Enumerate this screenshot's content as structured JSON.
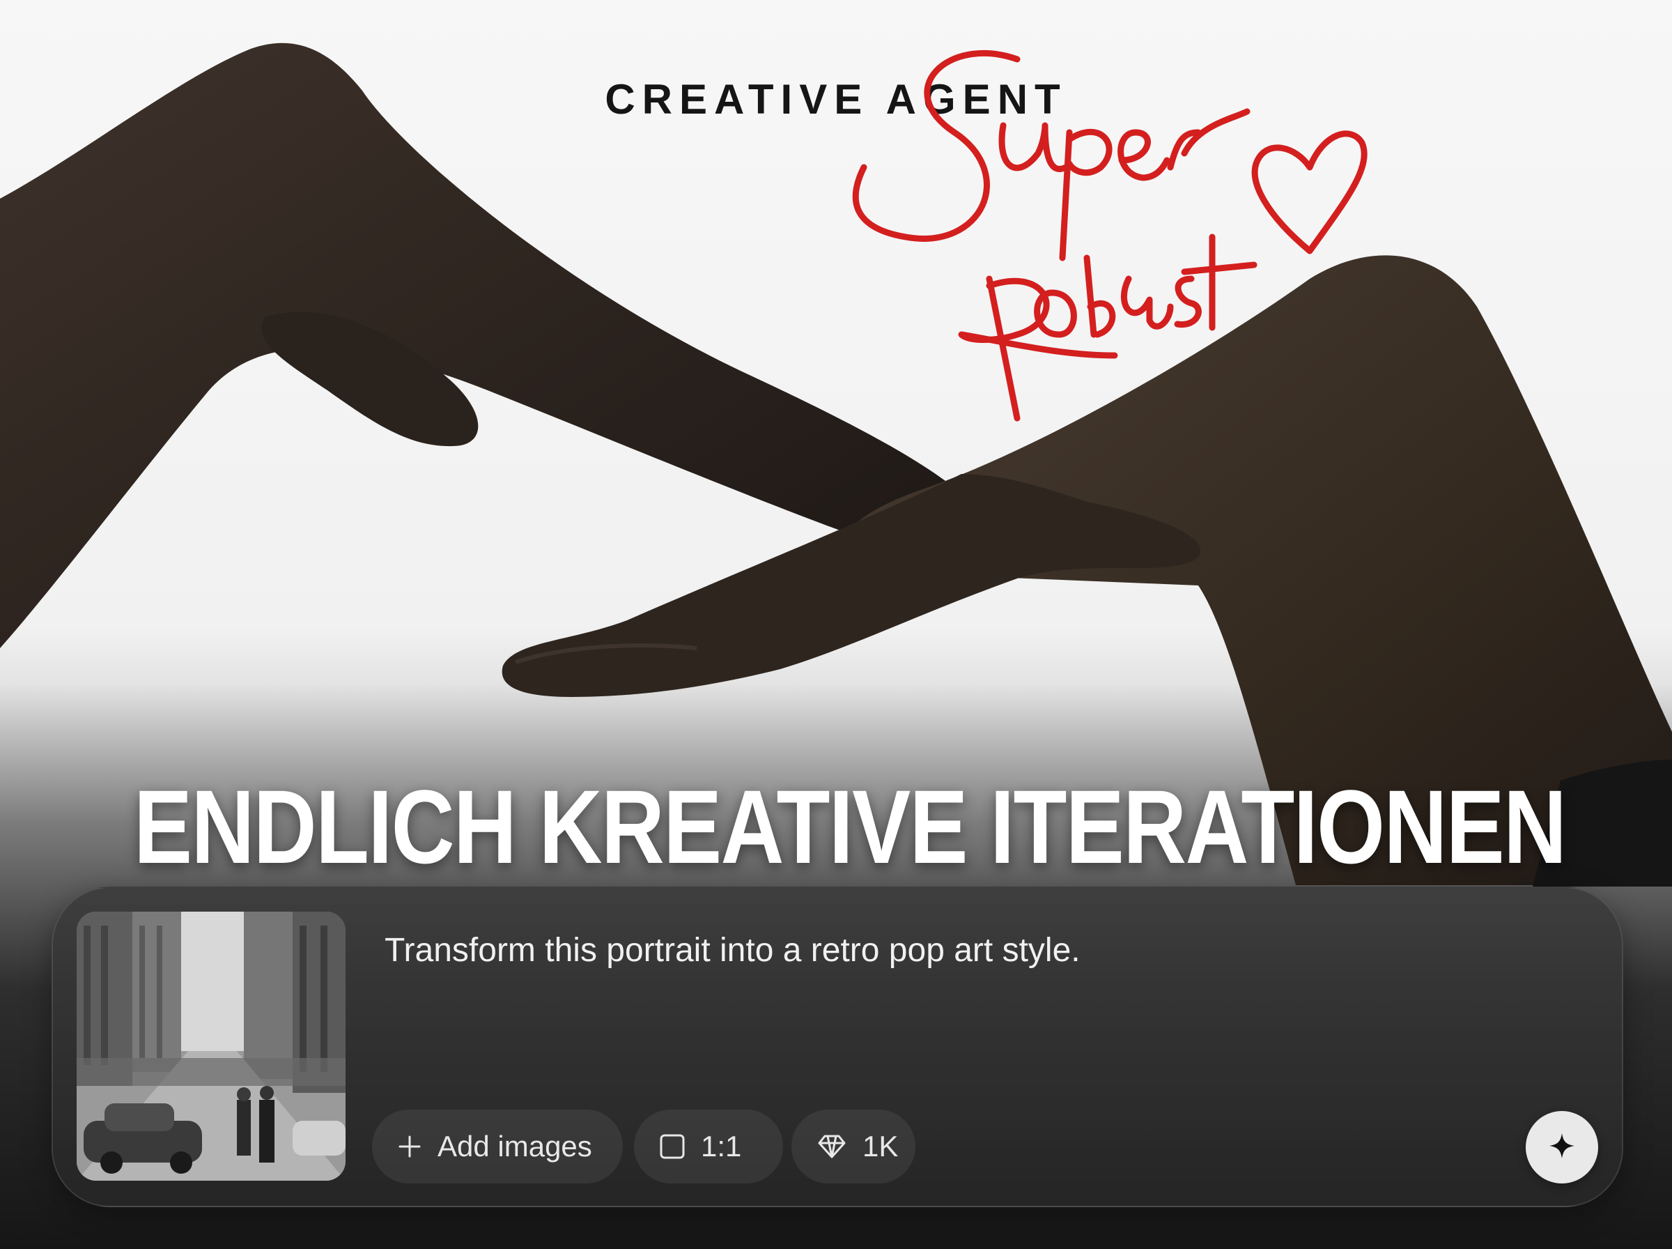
{
  "brand": {
    "title": "CREATIVE AGENT"
  },
  "signature": {
    "text": "Super Robust"
  },
  "headline": {
    "text": "ENDLICH KREATIVE ITERATIONEN"
  },
  "composer": {
    "prompt": "Transform this portrait into a retro pop art style.",
    "add_images_label": "Add images",
    "add_images_icon": "plus-icon",
    "aspect_ratio_label": "1:1",
    "aspect_ratio_icon": "square-icon",
    "resolution_label": "1K",
    "resolution_icon": "diamond-icon",
    "generate_icon": "sparkle-icon"
  },
  "colors": {
    "scribble_red": "#d41f1f",
    "headline": "#ffffff",
    "panel": "#2f2f2f"
  }
}
